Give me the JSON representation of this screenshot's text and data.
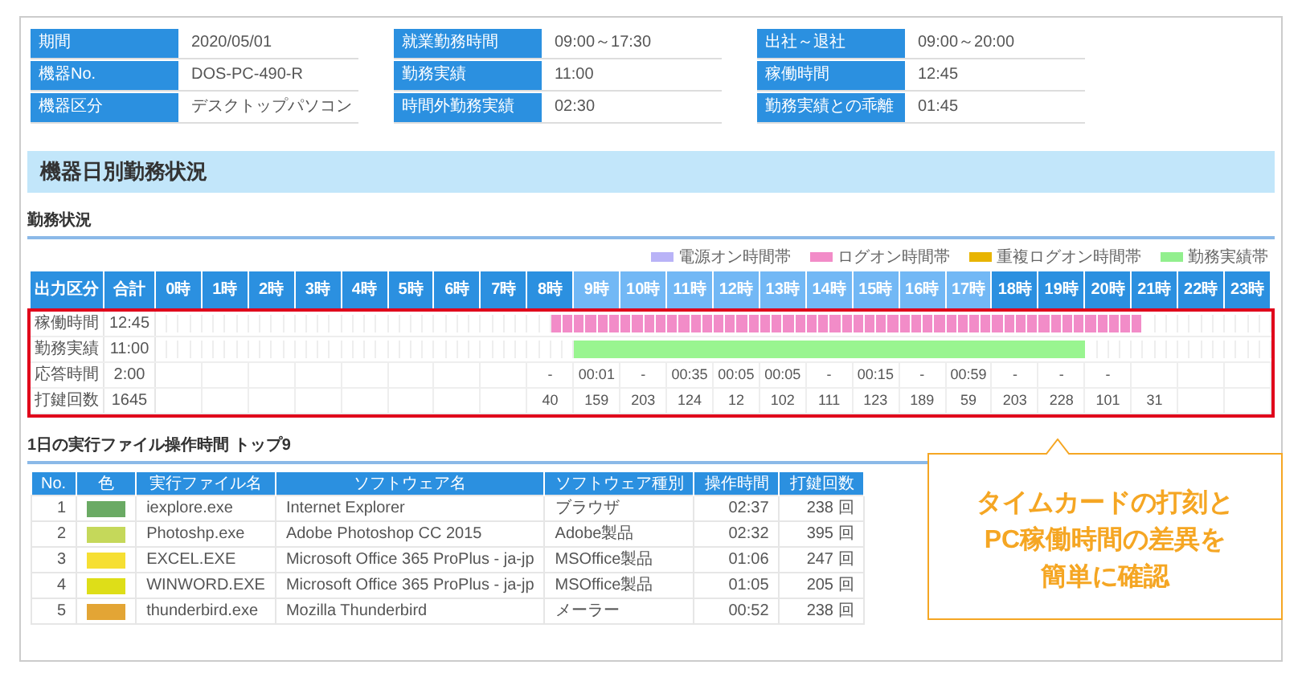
{
  "info_tables": [
    [
      {
        "label": "期間",
        "value": "2020/05/01"
      },
      {
        "label": "機器No.",
        "value": "DOS-PC-490-R"
      },
      {
        "label": "機器区分",
        "value": "デスクトップパソコン"
      }
    ],
    [
      {
        "label": "就業勤務時間",
        "value": "09:00～17:30"
      },
      {
        "label": "勤務実績",
        "value": "11:00"
      },
      {
        "label": "時間外勤務実績",
        "value": "02:30"
      }
    ],
    [
      {
        "label": "出社～退社",
        "value": "09:00～20:00"
      },
      {
        "label": "稼働時間",
        "value": "12:45"
      },
      {
        "label": "勤務実績との乖離",
        "value": "01:45"
      }
    ]
  ],
  "section_title": "機器日別勤務状況",
  "status": {
    "title": "勤務状況",
    "legend": [
      {
        "label": "電源オン時間帯",
        "color": "#b9b3f7"
      },
      {
        "label": "ログオン時間帯",
        "color": "#f28cc8"
      },
      {
        "label": "重複ログオン時間帯",
        "color": "#e8b400"
      },
      {
        "label": "勤務実績帯",
        "color": "#92ef8e"
      }
    ],
    "header": {
      "label": "出力区分",
      "total": "合計"
    },
    "hours": [
      {
        "label": "0時",
        "work_hours": false
      },
      {
        "label": "1時",
        "work_hours": false
      },
      {
        "label": "2時",
        "work_hours": false
      },
      {
        "label": "3時",
        "work_hours": false
      },
      {
        "label": "4時",
        "work_hours": false
      },
      {
        "label": "5時",
        "work_hours": false
      },
      {
        "label": "6時",
        "work_hours": false
      },
      {
        "label": "7時",
        "work_hours": false
      },
      {
        "label": "8時",
        "work_hours": false
      },
      {
        "label": "9時",
        "work_hours": true
      },
      {
        "label": "10時",
        "work_hours": true
      },
      {
        "label": "11時",
        "work_hours": true
      },
      {
        "label": "12時",
        "work_hours": true
      },
      {
        "label": "13時",
        "work_hours": true
      },
      {
        "label": "14時",
        "work_hours": true
      },
      {
        "label": "15時",
        "work_hours": true
      },
      {
        "label": "16時",
        "work_hours": true
      },
      {
        "label": "17時",
        "work_hours": true
      },
      {
        "label": "18時",
        "work_hours": false
      },
      {
        "label": "19時",
        "work_hours": false
      },
      {
        "label": "20時",
        "work_hours": false
      },
      {
        "label": "21時",
        "work_hours": false
      },
      {
        "label": "22時",
        "work_hours": false
      },
      {
        "label": "23時",
        "work_hours": false
      }
    ],
    "rows": [
      {
        "kind": "segmented_bar",
        "label": "稼働時間",
        "total": "12:45",
        "color": "#f28cc8",
        "slots": [
          false,
          false,
          false,
          false,
          false,
          false,
          false,
          false,
          false,
          false,
          false,
          false,
          false,
          false,
          false,
          false,
          false,
          false,
          false,
          false,
          false,
          false,
          false,
          false,
          false,
          false,
          false,
          false,
          false,
          false,
          false,
          false,
          false,
          false,
          true,
          true,
          true,
          true,
          true,
          true,
          true,
          true,
          true,
          true,
          true,
          true,
          true,
          true,
          true,
          true,
          true,
          true,
          true,
          true,
          true,
          true,
          true,
          true,
          true,
          true,
          true,
          true,
          true,
          true,
          true,
          true,
          true,
          true,
          true,
          true,
          true,
          true,
          true,
          true,
          true,
          true,
          true,
          true,
          true,
          true,
          true,
          true,
          true,
          true,
          true,
          false,
          false,
          false,
          false,
          false,
          false,
          false,
          false,
          false,
          false,
          false
        ]
      },
      {
        "kind": "bar",
        "label": "勤務実績",
        "total": "11:00",
        "color": "#99f590",
        "slots": [
          false,
          false,
          false,
          false,
          false,
          false,
          false,
          false,
          false,
          false,
          false,
          false,
          false,
          false,
          false,
          false,
          false,
          false,
          false,
          false,
          false,
          false,
          false,
          false,
          false,
          false,
          false,
          false,
          false,
          false,
          false,
          false,
          false,
          false,
          false,
          false,
          true,
          true,
          true,
          true,
          true,
          true,
          true,
          true,
          true,
          true,
          true,
          true,
          true,
          true,
          true,
          true,
          true,
          true,
          true,
          true,
          true,
          true,
          true,
          true,
          true,
          true,
          true,
          true,
          true,
          true,
          true,
          true,
          true,
          true,
          true,
          true,
          true,
          true,
          true,
          true,
          true,
          true,
          true,
          true,
          false,
          false,
          false,
          false,
          false,
          false,
          false,
          false,
          false,
          false,
          false,
          false,
          false,
          false,
          false,
          false
        ]
      },
      {
        "kind": "text",
        "label": "応答時間",
        "total": "2:00",
        "cells": [
          null,
          null,
          null,
          null,
          null,
          null,
          null,
          null,
          "-",
          "00:01",
          "-",
          "00:35",
          "00:05",
          "00:05",
          "-",
          "00:15",
          "-",
          "00:59",
          "-",
          "-",
          "-",
          null,
          null,
          null
        ]
      },
      {
        "kind": "text",
        "label": "打鍵回数",
        "total": "1645",
        "cells": [
          null,
          null,
          null,
          null,
          null,
          null,
          null,
          null,
          "40",
          "159",
          "203",
          "124",
          "12",
          "102",
          "111",
          "123",
          "189",
          "59",
          "203",
          "228",
          "101",
          "31",
          null,
          null
        ]
      }
    ]
  },
  "top_files": {
    "title": "1日の実行ファイル操作時間 トップ9",
    "columns": [
      "No.",
      "色",
      "実行ファイル名",
      "ソフトウェア名",
      "ソフトウェア種別",
      "操作時間",
      "打鍵回数"
    ],
    "rows": [
      {
        "no": "1",
        "color": "#6aaa64",
        "file": "iexplore.exe",
        "software": "Internet Explorer",
        "type": "ブラウザ",
        "time": "02:37",
        "keys": "238 回"
      },
      {
        "no": "2",
        "color": "#c5d85a",
        "file": "Photoshp.exe",
        "software": "Adobe Photoshop CC 2015",
        "type": "Adobe製品",
        "time": "02:32",
        "keys": "395 回"
      },
      {
        "no": "3",
        "color": "#f6df32",
        "file": "EXCEL.EXE",
        "software": "Microsoft Office 365 ProPlus - ja-jp",
        "type": "MSOffice製品",
        "time": "01:06",
        "keys": "247 回"
      },
      {
        "no": "4",
        "color": "#dede18",
        "file": "WINWORD.EXE",
        "software": "Microsoft Office 365 ProPlus - ja-jp",
        "type": "MSOffice製品",
        "time": "01:05",
        "keys": "205 回"
      },
      {
        "no": "5",
        "color": "#e3a535",
        "file": "thunderbird.exe",
        "software": "Mozilla Thunderbird",
        "type": "メーラー",
        "time": "00:52",
        "keys": "238 回"
      }
    ]
  },
  "callout": {
    "lines": [
      "タイムカードの打刻と",
      "PC稼働時間の差異を",
      "簡単に確認"
    ]
  }
}
